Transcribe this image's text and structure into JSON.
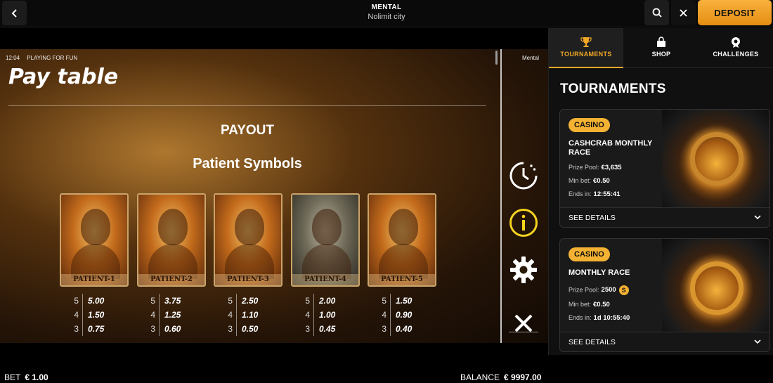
{
  "header": {
    "title": "MENTAL",
    "provider": "Nolimit city",
    "deposit_label": "DEPOSIT"
  },
  "game": {
    "clock": "12:04",
    "mode": "PLAYING FOR FUN",
    "game_label": "Mental",
    "paytable_title": "Pay table",
    "payout_heading": "PAYOUT",
    "symbols_heading": "Patient Symbols",
    "patients": [
      {
        "name": "PATIENT-1",
        "pays": [
          {
            "n": "5",
            "v": "5.00"
          },
          {
            "n": "4",
            "v": "1.50"
          },
          {
            "n": "3",
            "v": "0.75"
          }
        ]
      },
      {
        "name": "PATIENT-2",
        "pays": [
          {
            "n": "5",
            "v": "3.75"
          },
          {
            "n": "4",
            "v": "1.25"
          },
          {
            "n": "3",
            "v": "0.60"
          }
        ]
      },
      {
        "name": "PATIENT-3",
        "pays": [
          {
            "n": "5",
            "v": "2.50"
          },
          {
            "n": "4",
            "v": "1.10"
          },
          {
            "n": "3",
            "v": "0.50"
          }
        ]
      },
      {
        "name": "PATIENT-4",
        "pays": [
          {
            "n": "5",
            "v": "2.00"
          },
          {
            "n": "4",
            "v": "1.00"
          },
          {
            "n": "3",
            "v": "0.45"
          }
        ]
      },
      {
        "name": "PATIENT-5",
        "pays": [
          {
            "n": "5",
            "v": "1.50"
          },
          {
            "n": "4",
            "v": "0.90"
          },
          {
            "n": "3",
            "v": "0.40"
          }
        ]
      }
    ],
    "side_icons": [
      "history-clock-icon",
      "info-icon",
      "settings-gear-icon",
      "close-x-icon"
    ],
    "accent_yellow": "#f3d31f",
    "bet_label": "BET",
    "bet_value": "€ 1.00",
    "balance_label": "BALANCE",
    "balance_value": "€ 9997.00"
  },
  "panel": {
    "tabs": [
      {
        "label": "TOURNAMENTS",
        "icon": "trophy-icon",
        "active": true
      },
      {
        "label": "SHOP",
        "icon": "shopping-bag-icon",
        "active": false
      },
      {
        "label": "CHALLENGES",
        "icon": "badge-icon",
        "active": false
      }
    ],
    "title": "TOURNAMENTS",
    "accent": "#f1a827",
    "tournaments": [
      {
        "badge": "CASINO",
        "name": "CASHCRAB MONTHLY RACE",
        "prize_label": "Prize Pool:",
        "prize_value": "€3,635",
        "minbet_label": "Min bet:",
        "minbet_value": "€0.50",
        "ends_label": "Ends in:",
        "ends_value": "12:55:41",
        "details_label": "SEE DETAILS"
      },
      {
        "badge": "CASINO",
        "name": "MONTHLY RACE",
        "prize_label": "Prize Pool:",
        "prize_value": "2500",
        "coin_symbol": "S",
        "minbet_label": "Min bet:",
        "minbet_value": "€0.50",
        "ends_label": "Ends in:",
        "ends_value": "1d 10:55:40",
        "details_label": "SEE DETAILS"
      }
    ]
  }
}
